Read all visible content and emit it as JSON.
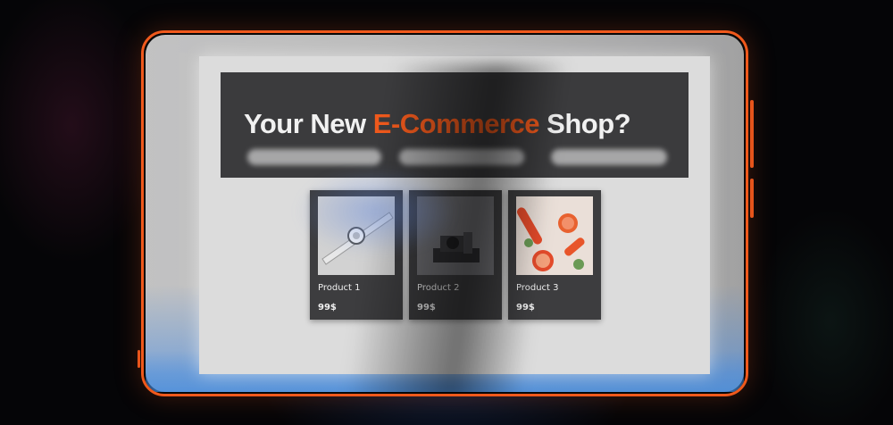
{
  "hero": {
    "title_prefix": "Your New ",
    "title_accent": "E-Commerce",
    "title_suffix": " Shop?"
  },
  "products": [
    {
      "name": "Product 1",
      "price": "99$",
      "image_icon": "smartwatch-image"
    },
    {
      "name": "Product 2",
      "price": "99$",
      "image_icon": "camera-image"
    },
    {
      "name": "Product 3",
      "price": "99$",
      "image_icon": "grapefruit-image"
    }
  ],
  "colors": {
    "accent": "#f0591c",
    "frame": "#f0591c",
    "hero_background": "#3b3b3d",
    "card_background": "#3d3d3f",
    "screen_background": "#dcdcdc"
  }
}
